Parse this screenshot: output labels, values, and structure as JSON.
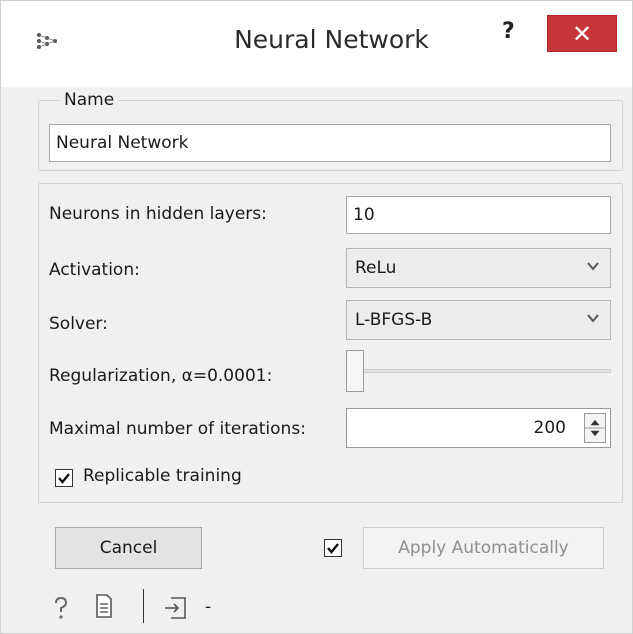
{
  "window": {
    "title": "Neural Network",
    "help_label": "?",
    "close_label": "✕"
  },
  "name_group": {
    "legend": "Name",
    "value": "Neural Network"
  },
  "params": {
    "neurons_label": "Neurons in hidden layers:",
    "neurons_value": "10",
    "activation_label": "Activation:",
    "activation_value": "ReLu",
    "solver_label": "Solver:",
    "solver_value": "L-BFGS-B",
    "regularization_label": "Regularization, α=0.0001:",
    "regularization_level": 0,
    "iterations_label": "Maximal number of iterations:",
    "iterations_value": "200",
    "replicable_label": "Replicable training",
    "replicable_checked": true
  },
  "footer": {
    "cancel_label": "Cancel",
    "auto_apply_checked": true,
    "apply_label": "Apply Automatically",
    "input_label": "-"
  },
  "icons": {
    "app": "neural-network-icon",
    "help": "question-mark-icon",
    "report": "document-icon",
    "input": "input-arrow-icon",
    "check": "checkmark-icon",
    "dropdown": "chevron-down-icon",
    "spin": "spin-arrows-icon"
  }
}
